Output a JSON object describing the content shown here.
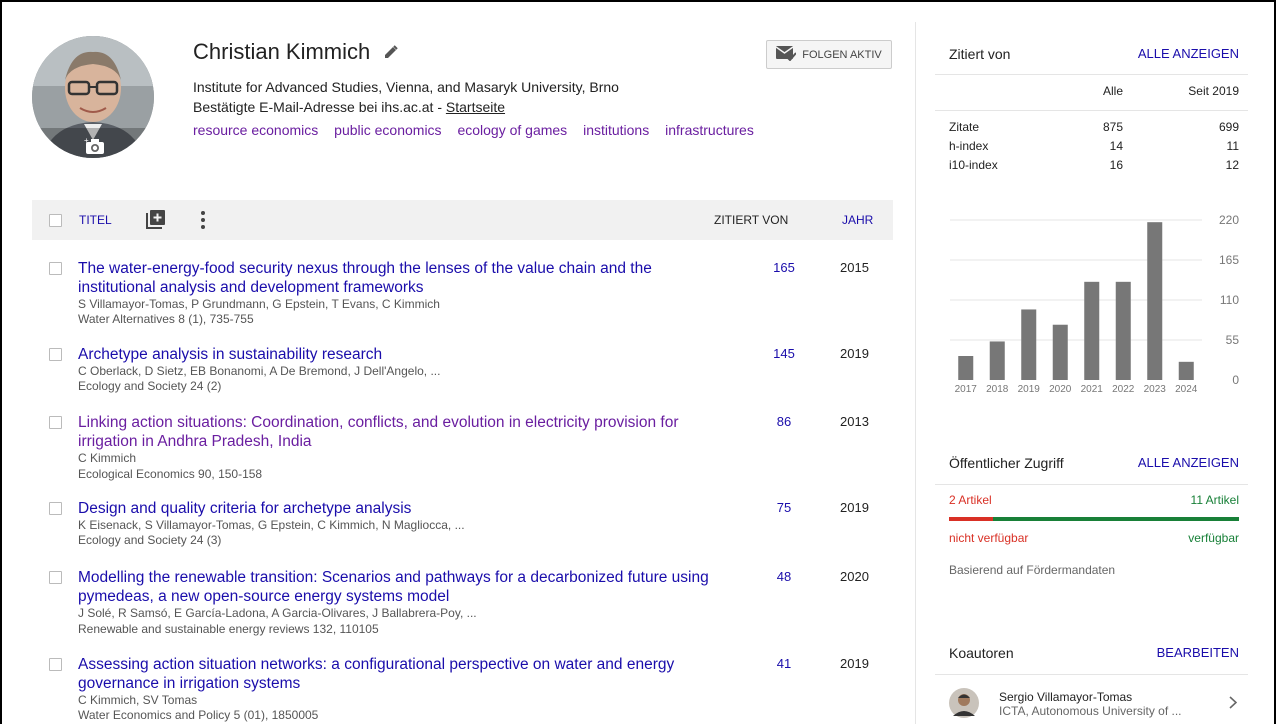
{
  "profile": {
    "name": "Christian Kimmich",
    "affiliation": "Institute for Advanced Studies, Vienna, and Masaryk University, Brno",
    "email_text": "Bestätigte E-Mail-Adresse bei ihs.ac.at - ",
    "homepage_label": "Startseite",
    "interests": [
      "resource economics",
      "public economics",
      "ecology of games",
      "institutions",
      "infrastructures"
    ],
    "follow_label": "FOLGEN AKTIV"
  },
  "table": {
    "title_col": "TITEL",
    "cited_col": "ZITIERT VON",
    "year_col": "JAHR"
  },
  "articles": [
    {
      "title": "The water-energy-food security nexus through the lenses of the value chain and the institutional analysis and development frameworks",
      "authors": "S Villamayor-Tomas, P Grundmann, G Epstein, T Evans, C Kimmich",
      "source": "Water Alternatives 8 (1), 735-755",
      "cited": "165",
      "year": "2015"
    },
    {
      "title": "Archetype analysis in sustainability research",
      "authors": "C Oberlack, D Sietz, EB Bonanomi, A De Bremond, J Dell'Angelo, ...",
      "source": "Ecology and Society 24 (2)",
      "cited": "145",
      "year": "2019"
    },
    {
      "title": "Linking action situations: Coordination, conflicts, and evolution in electricity provision for irrigation in Andhra Pradesh, India",
      "authors": "C Kimmich",
      "source": "Ecological Economics 90, 150-158",
      "cited": "86",
      "year": "2013"
    },
    {
      "title": "Design and quality criteria for archetype analysis",
      "authors": "K Eisenack, S Villamayor-Tomas, G Epstein, C Kimmich, N Magliocca, ...",
      "source": "Ecology and Society 24 (3)",
      "cited": "75",
      "year": "2019"
    },
    {
      "title": "Modelling the renewable transition: Scenarios and pathways for a decarbonized future using pymedeas, a new open-source energy systems model",
      "authors": "J Solé, R Samsó, E García-Ladona, A Garcia-Olivares, J Ballabrera-Poy, ...",
      "source": "Renewable and sustainable energy reviews 132, 110105",
      "cited": "48",
      "year": "2020"
    },
    {
      "title": "Assessing action situation networks: a configurational perspective on water and energy governance in irrigation systems",
      "authors": "C Kimmich, SV Tomas",
      "source": "Water Economics and Policy 5 (01), 1850005",
      "cited": "41",
      "year": "2019"
    }
  ],
  "cited_by": {
    "heading": "Zitiert von",
    "show_all": "ALLE ANZEIGEN",
    "col_all": "Alle",
    "col_since": "Seit 2019",
    "rows": [
      {
        "label": "Zitate",
        "all": "875",
        "since": "699"
      },
      {
        "label": "h-index",
        "all": "14",
        "since": "11"
      },
      {
        "label": "i10-index",
        "all": "16",
        "since": "12"
      }
    ]
  },
  "chart_data": {
    "type": "bar",
    "categories": [
      "2017",
      "2018",
      "2019",
      "2020",
      "2021",
      "2022",
      "2023",
      "2024"
    ],
    "values": [
      33,
      53,
      97,
      76,
      135,
      135,
      217,
      25
    ],
    "yticks": [
      "0",
      "55",
      "110",
      "165",
      "220"
    ],
    "ylim": [
      0,
      220
    ],
    "bar_color": "#777777"
  },
  "public_access": {
    "heading": "Öffentlicher Zugriff",
    "show_all": "ALLE ANZEIGEN",
    "unavailable_count": "2 Artikel",
    "available_count": "11 Artikel",
    "unavailable_label": "nicht verfügbar",
    "available_label": "verfügbar",
    "note": "Basierend auf Fördermandaten",
    "unavailable_color": "#d93025",
    "available_color": "#188038"
  },
  "coauthors": {
    "heading": "Koautoren",
    "edit": "BEARBEITEN",
    "items": [
      {
        "name": "Sergio Villamayor-Tomas",
        "affiliation": "ICTA, Autonomous University of ..."
      }
    ]
  }
}
